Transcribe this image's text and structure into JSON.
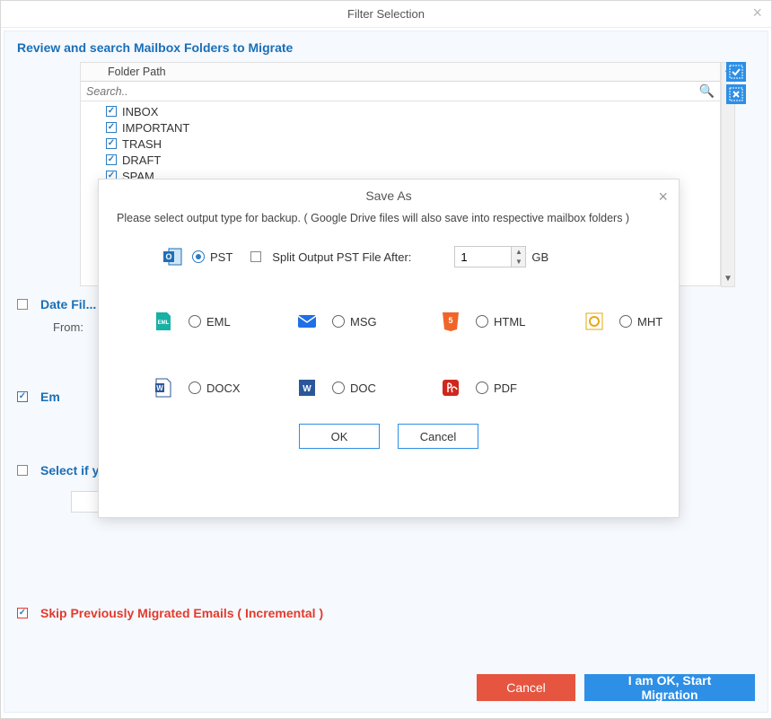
{
  "window": {
    "title": "Filter Selection"
  },
  "panel": {
    "heading": "Review and search Mailbox Folders to Migrate",
    "column_header": "Folder Path",
    "search_placeholder": "Search..",
    "folders": [
      {
        "label": "INBOX",
        "checked": true
      },
      {
        "label": "IMPORTANT",
        "checked": true
      },
      {
        "label": "TRASH",
        "checked": true
      },
      {
        "label": "DRAFT",
        "checked": true
      },
      {
        "label": "SPAM",
        "checked": true
      }
    ],
    "date_filter": {
      "label": "Date Fil...",
      "from_label": "From:"
    },
    "email_filter": {
      "label": "Em"
    },
    "select_if": {
      "label": "Select if yo"
    },
    "skip": {
      "label": "Skip Previously Migrated Emails ( Incremental )",
      "checked": true
    }
  },
  "buttons": {
    "cancel": "Cancel",
    "start": "I am OK, Start Migration"
  },
  "modal": {
    "title": "Save As",
    "hint": "Please select output type for backup. ( Google Drive files will also save into respective mailbox folders )",
    "pst_label": "PST",
    "split_label": "Split Output PST File After:",
    "split_value": "1",
    "gb_label": "GB",
    "formats": {
      "eml": "EML",
      "msg": "MSG",
      "html": "HTML",
      "mht": "MHT",
      "docx": "DOCX",
      "doc": "DOC",
      "pdf": "PDF"
    },
    "ok": "OK",
    "cancel": "Cancel"
  }
}
